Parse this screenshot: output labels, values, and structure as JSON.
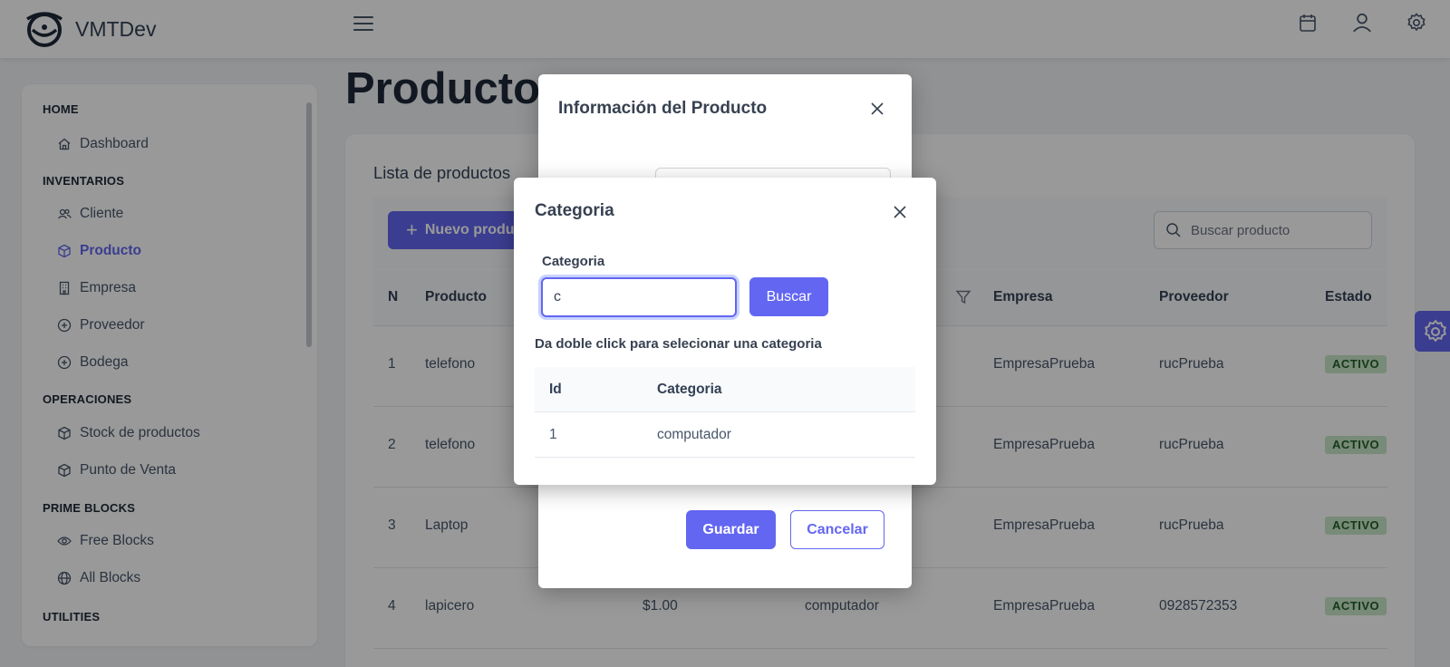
{
  "brand": {
    "name": "VMTDev"
  },
  "sidebar": {
    "sections": [
      {
        "title": "HOME",
        "items": [
          {
            "label": "Dashboard",
            "icon": "home-icon"
          }
        ]
      },
      {
        "title": "INVENTARIOS",
        "items": [
          {
            "label": "Cliente",
            "icon": "users-icon"
          },
          {
            "label": "Producto",
            "icon": "box-icon",
            "active": true
          },
          {
            "label": "Empresa",
            "icon": "building-icon"
          },
          {
            "label": "Proveedor",
            "icon": "plus-circle-icon"
          },
          {
            "label": "Bodega",
            "icon": "plus-circle-icon"
          }
        ]
      },
      {
        "title": "OPERACIONES",
        "items": [
          {
            "label": "Stock de productos",
            "icon": "box-icon"
          },
          {
            "label": "Punto de Venta",
            "icon": "box-icon"
          }
        ]
      },
      {
        "title": "PRIME BLOCKS",
        "items": [
          {
            "label": "Free Blocks",
            "icon": "eye-icon"
          },
          {
            "label": "All Blocks",
            "icon": "globe-icon"
          }
        ]
      },
      {
        "title": "UTILITIES",
        "items": []
      }
    ]
  },
  "main": {
    "page_title": "Producto",
    "card_title": "Lista de productos",
    "new_button": "Nuevo producto",
    "search_placeholder": "Buscar producto",
    "columns": [
      "N",
      "Producto",
      "Empresa",
      "Proveedor",
      "Estado"
    ],
    "rows": [
      {
        "n": "1",
        "producto": "telefono",
        "precio": "",
        "categoria": "",
        "empresa": "EmpresaPrueba",
        "proveedor": "rucPrueba",
        "estado": "ACTIVO"
      },
      {
        "n": "2",
        "producto": "telefono",
        "precio": "",
        "categoria": "",
        "empresa": "EmpresaPrueba",
        "proveedor": "rucPrueba",
        "estado": "ACTIVO"
      },
      {
        "n": "3",
        "producto": "Laptop",
        "precio": "",
        "categoria": "",
        "empresa": "EmpresaPrueba",
        "proveedor": "rucPrueba",
        "estado": "ACTIVO"
      },
      {
        "n": "4",
        "producto": "lapicero",
        "precio": "$1.00",
        "categoria": "computador",
        "empresa": "EmpresaPrueba",
        "proveedor": "0928572353",
        "estado": "ACTIVO"
      }
    ]
  },
  "product_dialog": {
    "title": "Información del Producto",
    "save_label": "Guardar",
    "cancel_label": "Cancelar"
  },
  "category_dialog": {
    "title": "Categoria",
    "field_label": "Categoria",
    "input_value": "c",
    "search_label": "Buscar",
    "hint": "Da doble click para selecionar una categoria",
    "columns": [
      "Id",
      "Categoria"
    ],
    "rows": [
      {
        "id": "1",
        "categoria": "computador"
      }
    ]
  },
  "colors": {
    "primary": "#6366f1",
    "badge_bg": "#c8e6c9",
    "badge_text": "#256029",
    "overlay": "rgba(0,0,0,0.4)"
  }
}
